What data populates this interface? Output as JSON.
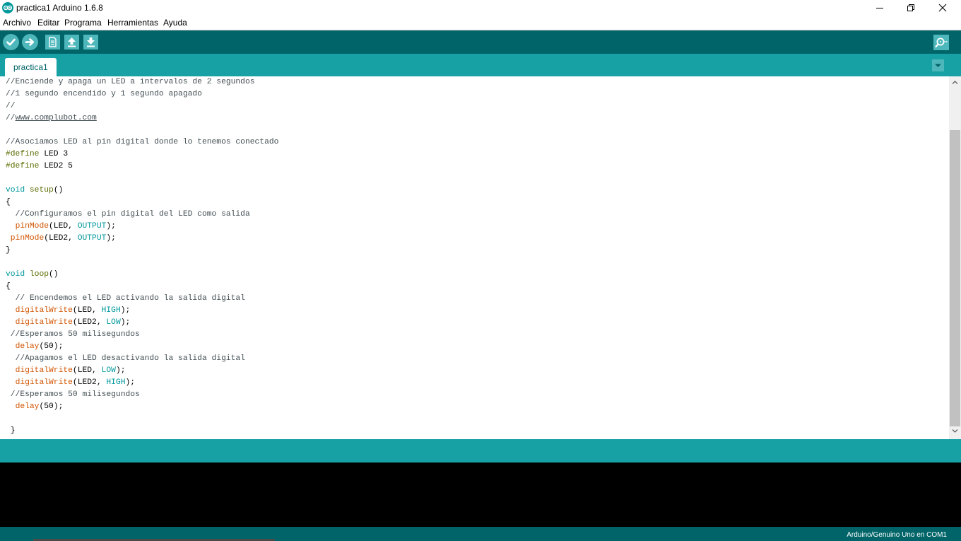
{
  "window": {
    "title": "practica1 Arduino 1.6.8",
    "app_icon": "arduino-logo-icon",
    "controls": [
      "minimize-icon",
      "restore-icon",
      "close-icon"
    ]
  },
  "menu": {
    "items": [
      "Archivo",
      "Editar",
      "Programa",
      "Herramientas",
      "Ayuda"
    ]
  },
  "toolbar": {
    "buttons": [
      {
        "name": "verify",
        "icon": "check-icon"
      },
      {
        "name": "upload",
        "icon": "arrow-right-icon"
      },
      {
        "name": "new",
        "icon": "new-file-icon"
      },
      {
        "name": "open",
        "icon": "arrow-up-icon"
      },
      {
        "name": "save",
        "icon": "arrow-down-icon"
      }
    ],
    "serial_monitor_icon": "magnifier-icon"
  },
  "tabs": [
    {
      "label": "practica1",
      "active": true
    }
  ],
  "editor": {
    "lines": [
      "//Enciende y apaga un LED a intervalos de 2 segundos",
      "//1 segundo encendido y 1 segundo apagado",
      "//",
      "//www.complubot.com",
      "",
      "//Asociamos LED al pin digital donde lo tenemos conectado",
      "#define LED 3",
      "#define LED2 5",
      "",
      "void setup()",
      "{",
      "  //Configuramos el pin digital del LED como salida",
      "  pinMode(LED, OUTPUT);",
      " pinMode(LED2, OUTPUT);",
      "}",
      "",
      "void loop()",
      "{",
      "  // Encendemos el LED activando la salida digital",
      "  digitalWrite(LED, HIGH);",
      "  digitalWrite(LED2, LOW);",
      " //Esperamos 50 milisegundos",
      "  delay(50);",
      "  //Apagamos el LED desactivando la salida digital",
      "  digitalWrite(LED, LOW);",
      "  digitalWrite(LED2, HIGH);",
      " //Esperamos 50 milisegundos",
      "  delay(50);",
      "",
      " }"
    ]
  },
  "status": {
    "message": "",
    "board": "Arduino/Genuino Uno en COM1"
  },
  "colors": {
    "toolbar": "#006468",
    "tabbar": "#17a1a5",
    "button": "#4db7bb",
    "keyword": "#00979c",
    "function": "#d35400",
    "comment": "#434f54",
    "preprocessor": "#5e6d03",
    "console": "#000000"
  }
}
